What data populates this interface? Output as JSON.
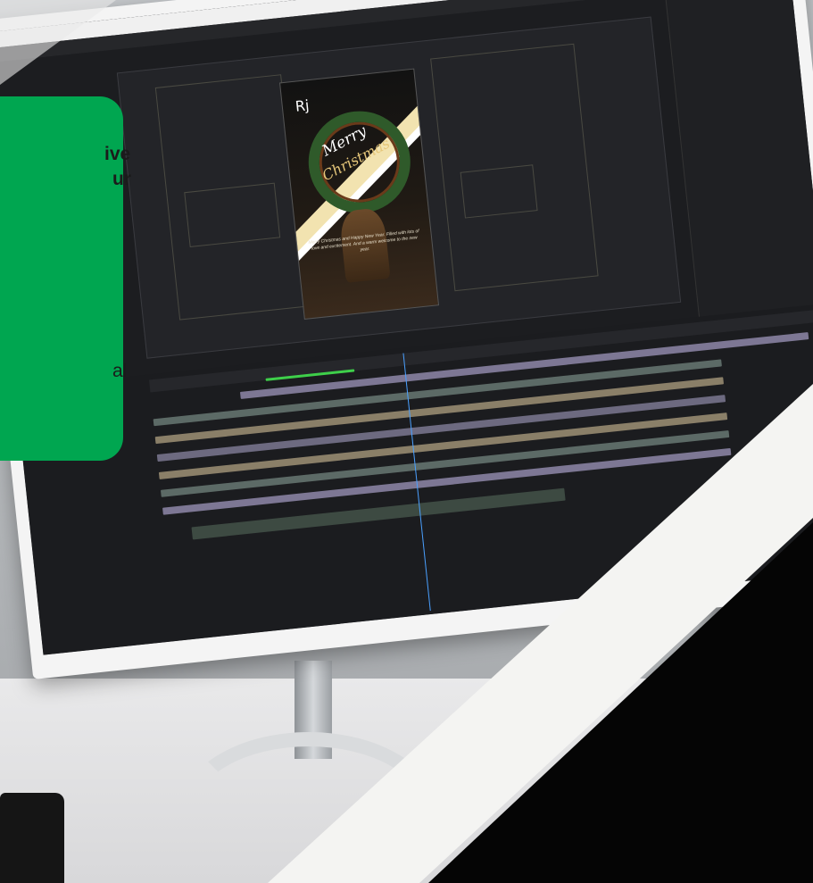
{
  "promo": {
    "line1": "ive",
    "line2": "ur",
    "line3": "al"
  },
  "artwork": {
    "brand_mark": "Rj",
    "title_1": "Merry",
    "title_2": "Christmas",
    "greeting": "Merry Christmas and Happy New Year. Filled with lots of love and excitement. And a warm welcome to the new year."
  },
  "colors": {
    "promo_green": "#00a650",
    "overlay_dark": "#050505",
    "overlay_white": "#f4f4f2"
  }
}
